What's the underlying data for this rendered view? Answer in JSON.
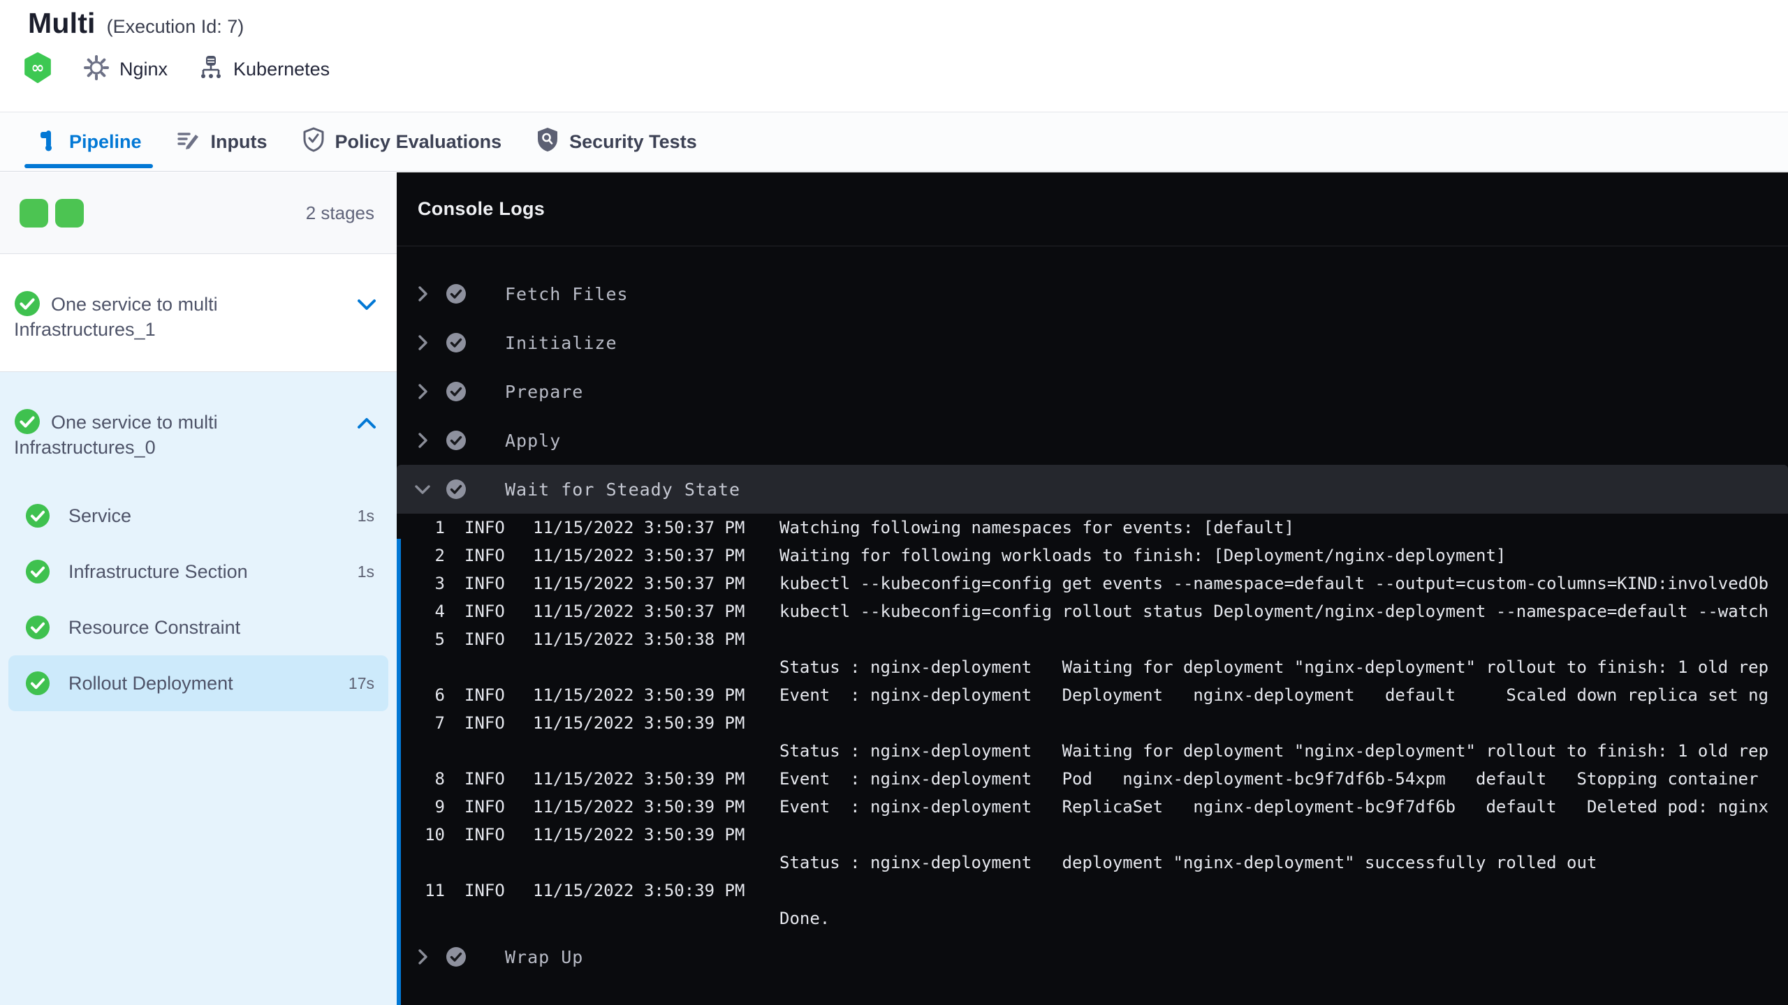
{
  "header": {
    "title": "Multi",
    "execution_id": "(Execution Id: 7)",
    "services": [
      {
        "icon": "harness-cd-icon",
        "label": "Nginx"
      },
      {
        "icon": "infrastructure-icon",
        "label": "Kubernetes"
      }
    ]
  },
  "tabs": [
    {
      "label": "Pipeline",
      "icon": "pipeline-icon",
      "active": true
    },
    {
      "label": "Inputs",
      "icon": "inputs-icon",
      "active": false
    },
    {
      "label": "Policy Evaluations",
      "icon": "shield-check-icon",
      "active": false
    },
    {
      "label": "Security Tests",
      "icon": "shield-search-icon",
      "active": false
    }
  ],
  "sidebar": {
    "stage_count_label": "2 stages",
    "stages": [
      {
        "label": "One service to multi Infrastructures_1",
        "status": "success",
        "expanded": false
      },
      {
        "label": "One service to multi Infrastructures_0",
        "status": "success",
        "expanded": true
      }
    ],
    "steps": [
      {
        "label": "Service",
        "duration": "1s",
        "status": "success",
        "selected": false
      },
      {
        "label": "Infrastructure Section",
        "duration": "1s",
        "status": "success",
        "selected": false
      },
      {
        "label": "Resource Constraint",
        "duration": "",
        "status": "success",
        "selected": false
      },
      {
        "label": "Rollout Deployment",
        "duration": "17s",
        "status": "success",
        "selected": true
      }
    ]
  },
  "console": {
    "title": "Console Logs",
    "steps": [
      {
        "label": "Fetch Files",
        "status": "success",
        "expanded": false
      },
      {
        "label": "Initialize",
        "status": "success",
        "expanded": false
      },
      {
        "label": "Prepare",
        "status": "success",
        "expanded": false
      },
      {
        "label": "Apply",
        "status": "success",
        "expanded": false
      },
      {
        "label": "Wait for Steady State",
        "status": "success",
        "expanded": true,
        "logs": [
          {
            "num": "1",
            "level": "INFO",
            "time": "11/15/2022 3:50:37 PM",
            "msg": "Watching following namespaces for events: [default]"
          },
          {
            "num": "2",
            "level": "INFO",
            "time": "11/15/2022 3:50:37 PM",
            "msg": "Waiting for following workloads to finish: [Deployment/nginx-deployment]"
          },
          {
            "num": "3",
            "level": "INFO",
            "time": "11/15/2022 3:50:37 PM",
            "msg": "kubectl --kubeconfig=config get events --namespace=default --output=custom-columns=KIND:involvedOb"
          },
          {
            "num": "4",
            "level": "INFO",
            "time": "11/15/2022 3:50:37 PM",
            "msg": "kubectl --kubeconfig=config rollout status Deployment/nginx-deployment --namespace=default --watch"
          },
          {
            "num": "5",
            "level": "INFO",
            "time": "11/15/2022 3:50:38 PM",
            "msg": ""
          },
          {
            "num": "",
            "level": "",
            "time": "",
            "msg": "Status : nginx-deployment   Waiting for deployment \"nginx-deployment\" rollout to finish: 1 old rep"
          },
          {
            "num": "6",
            "level": "INFO",
            "time": "11/15/2022 3:50:39 PM",
            "msg": "Event  : nginx-deployment   Deployment   nginx-deployment   default     Scaled down replica set ng"
          },
          {
            "num": "7",
            "level": "INFO",
            "time": "11/15/2022 3:50:39 PM",
            "msg": ""
          },
          {
            "num": "",
            "level": "",
            "time": "",
            "msg": "Status : nginx-deployment   Waiting for deployment \"nginx-deployment\" rollout to finish: 1 old rep"
          },
          {
            "num": "8",
            "level": "INFO",
            "time": "11/15/2022 3:50:39 PM",
            "msg": "Event  : nginx-deployment   Pod   nginx-deployment-bc9f7df6b-54xpm   default   Stopping container"
          },
          {
            "num": "9",
            "level": "INFO",
            "time": "11/15/2022 3:50:39 PM",
            "msg": "Event  : nginx-deployment   ReplicaSet   nginx-deployment-bc9f7df6b   default   Deleted pod: nginx"
          },
          {
            "num": "10",
            "level": "INFO",
            "time": "11/15/2022 3:50:39 PM",
            "msg": ""
          },
          {
            "num": "",
            "level": "",
            "time": "",
            "msg": "Status : nginx-deployment   deployment \"nginx-deployment\" successfully rolled out"
          },
          {
            "num": "11",
            "level": "INFO",
            "time": "11/15/2022 3:50:39 PM",
            "msg": ""
          },
          {
            "num": "",
            "level": "",
            "time": "",
            "msg": "Done."
          }
        ]
      },
      {
        "label": "Wrap Up",
        "status": "success",
        "expanded": false
      }
    ]
  },
  "colors": {
    "accent_blue": "#0278d5",
    "success_green": "#42c452",
    "stage_selected_bg": "#cdeafb",
    "stage_section_bg": "#e6f3fc",
    "console_bg": "#0a0b0e",
    "console_selected_row_bg": "#25272d"
  }
}
